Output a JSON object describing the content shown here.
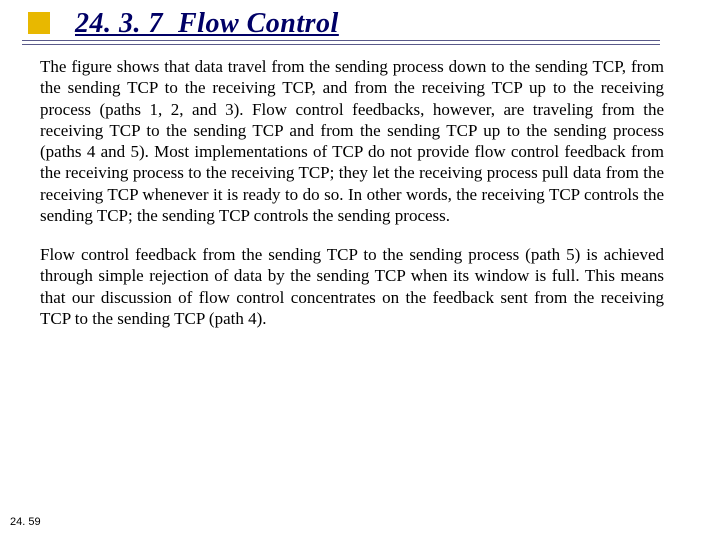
{
  "heading": {
    "section_number": "24. 3. 7",
    "title": "Flow Control"
  },
  "body": {
    "paragraph1": "The figure shows that data travel from the sending process down to the sending TCP, from the sending TCP to the receiving TCP, and from the receiving TCP up to the receiving process (paths 1, 2, and 3). Flow control feedbacks, however, are traveling from the receiving TCP to the sending TCP and from the sending TCP up to the sending process (paths 4 and 5). Most implementations of TCP do not provide flow control feedback from the receiving process to the receiving TCP; they let the receiving process pull data from the receiving TCP whenever it is ready to do so. In other words, the receiving TCP controls the sending TCP; the sending TCP controls the sending process.",
    "paragraph2": "Flow control feedback from the sending TCP to the sending process (path 5) is achieved through simple rejection of data by the sending TCP when its window is full. This means that our discussion of flow control concentrates on the feedback sent from the receiving TCP to the sending TCP (path 4)."
  },
  "footer": {
    "page_number": "24. 59"
  }
}
